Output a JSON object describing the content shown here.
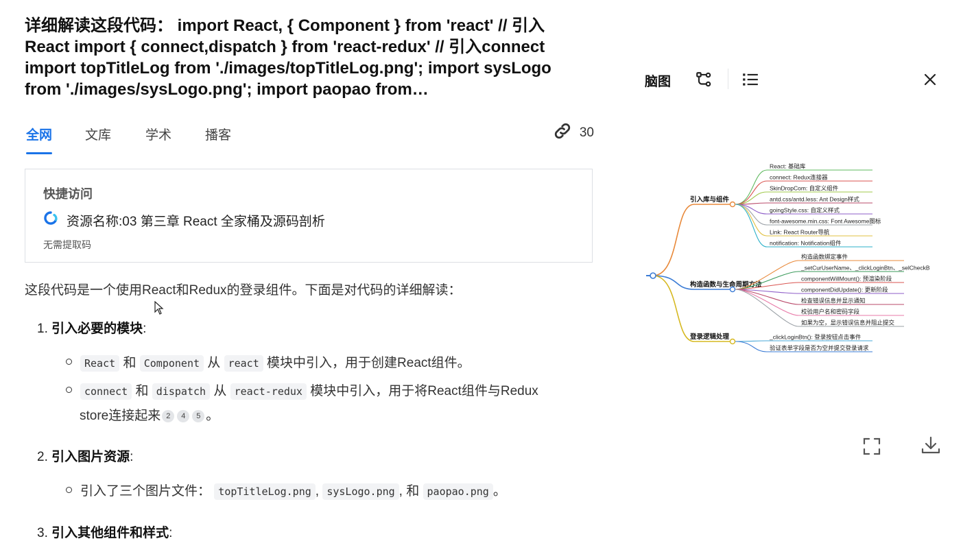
{
  "question": {
    "title": "详细解读这段代码： import React, { Component } from 'react' // 引入React import { connect,dispatch } from 'react-redux' // 引入connect import topTitleLog from './images/topTitleLog.png'; import sysLogo from './images/sysLogo.png'; import paopao from…"
  },
  "tabs": {
    "items": [
      "全网",
      "文库",
      "学术",
      "播客"
    ],
    "active": "全网",
    "link_count": "30"
  },
  "quick_access": {
    "title": "快捷访问",
    "resource": "资源名称:03 第三章 React 全家桶及源码剖析",
    "note": "无需提取码"
  },
  "answer": {
    "intro": "这段代码是一个使用React和Redux的登录组件。下面是对代码的详细解读：",
    "sections": [
      {
        "num": "1.",
        "heading": "引入必要的模块",
        "bullets": [
          {
            "a": "React",
            "t1": "和",
            "b": "Component",
            "t2": "从",
            "c": "react",
            "t3": "模块中引入，用于创建React组件。"
          },
          {
            "a": "connect",
            "t1": "和",
            "b": "dispatch",
            "t2": "从",
            "c": "react-redux",
            "t3": "模块中引入，用于将React组件与Redux",
            "t4": "store连接起来",
            "cites": [
              "2",
              "4",
              "5"
            ],
            "end": "。"
          }
        ]
      },
      {
        "num": "2.",
        "heading": "引入图片资源",
        "bullets": [
          {
            "t0": "引入了三个图片文件：",
            "a": "topTitleLog.png",
            "t1": ",",
            "b": "sysLogo.png",
            "t2": ", 和",
            "c": "paopao.png",
            "t3": "。"
          }
        ]
      },
      {
        "num": "3.",
        "heading": "引入其他组件和样式"
      }
    ]
  },
  "panel": {
    "label": "脑图",
    "icons": [
      "mindmap-icon",
      "list-icon",
      "close-icon",
      "fullscreen-icon",
      "download-icon"
    ]
  },
  "mindmap": {
    "branches": [
      {
        "label": "引入库与组件",
        "color": "#e8893a",
        "leaves": [
          {
            "text": "React: 基础库",
            "color": "#5cb85c"
          },
          {
            "text": "connect: Redux连接器",
            "color": "#d9534f"
          },
          {
            "text": "SkinDropCom: 自定义组件",
            "color": "#a0c94a"
          },
          {
            "text": "antd.css/antd.less: Ant Design样式",
            "color": "#b94a6a"
          },
          {
            "text": "goingStyle.css: 自定义样式",
            "color": "#8e5ec8"
          },
          {
            "text": "font-awesome.min.css: Font Awesome图标",
            "color": "#9aa0a6"
          },
          {
            "text": "Link: React Router导航",
            "color": "#e0c040"
          },
          {
            "text": "notification: Notification组件",
            "color": "#2bb0c8"
          }
        ]
      },
      {
        "label": "构造函数与生命周期方法",
        "color": "#3a7bd5",
        "leaves": [
          {
            "text": "构造函数绑定事件",
            "color": "#e8893a"
          },
          {
            "text": "_setCurUserName、_clickLoginBtn、_selCheckB",
            "color": "#3a9a5a"
          },
          {
            "text": "componentWillMount(): 预渲染阶段",
            "color": "#d9534f"
          },
          {
            "text": "componentDidUpdate(): 更新阶段",
            "color": "#8e5ec8"
          },
          {
            "text": "检查错误信息并显示通知",
            "color": "#b94a6a"
          },
          {
            "text": "校验用户名和密码字段",
            "color": "#e87aa8"
          },
          {
            "text": "如果为空，显示错误信息并阻止提交",
            "color": "#9aa0a6"
          }
        ]
      },
      {
        "label": "登录逻辑处理",
        "color": "#d6b820",
        "leaves": [
          {
            "text": "_clickLoginBtn(): 登录按钮点击事件",
            "color": "#4aa8d8"
          },
          {
            "text": "验证表单字段是否为空并提交登录请求",
            "color": "#3a7bd5"
          }
        ]
      }
    ]
  }
}
